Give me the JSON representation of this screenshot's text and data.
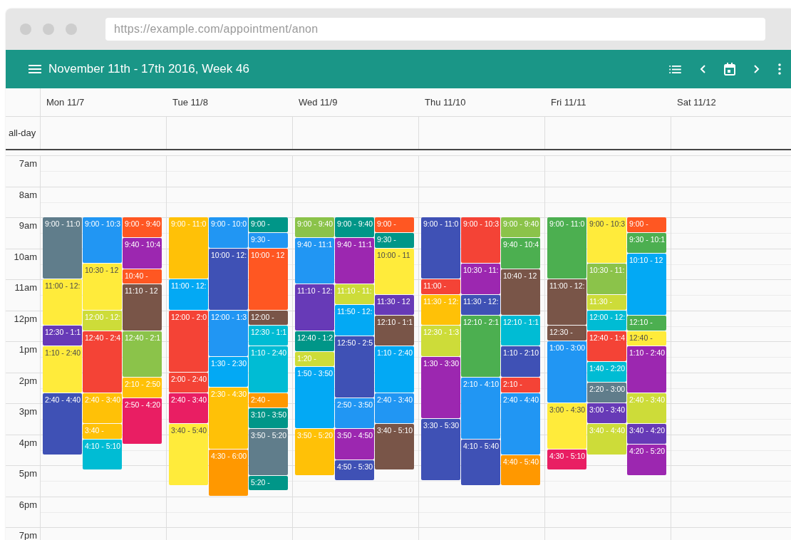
{
  "browser": {
    "url": "https://example.com/appointment/anon"
  },
  "toolbar": {
    "title": "November 11th - 17th 2016, Week 46"
  },
  "all_day_label": "all-day",
  "hours": [
    "7am",
    "8am",
    "9am",
    "10am",
    "11am",
    "12pm",
    "1pm",
    "2pm",
    "3pm",
    "4pm",
    "5pm",
    "6pm",
    "7pm"
  ],
  "days": [
    {
      "label": "Mon 11/7",
      "lanes": [
        [
          {
            "label": "9:00 - 11:0",
            "color": "#607d8b"
          },
          {
            "label": "11:00 - 12:",
            "color": "#ffeb3b"
          },
          {
            "label": "12:30 - 1:1",
            "color": "#673ab7"
          },
          {
            "label": "1:10 - 2:40",
            "color": "#ffeb3b"
          },
          {
            "label": "2:40 - 4:40",
            "color": "#3f51b5"
          }
        ],
        [
          {
            "label": "9:00 - 10:3",
            "color": "#2196f3"
          },
          {
            "label": "10:30 - 12",
            "color": "#ffeb3b"
          },
          {
            "label": "12:00 - 12:",
            "color": "#cddc39"
          },
          {
            "label": "12:40 - 2:4",
            "color": "#f44336"
          },
          {
            "label": "2:40 - 3:40",
            "color": "#ffc107"
          },
          {
            "label": "3:40 -",
            "color": "#ffc107"
          },
          {
            "label": "4:10 - 5:10",
            "color": "#00bcd4"
          }
        ],
        [
          {
            "label": "9:00 - 9:40",
            "color": "#ff5722"
          },
          {
            "label": "9:40 - 10:4",
            "color": "#9c27b0"
          },
          {
            "label": "10:40 -",
            "color": "#ff5722"
          },
          {
            "label": "11:10 - 12",
            "color": "#795548"
          },
          {
            "label": "12:40 - 2:1",
            "color": "#8bc34a"
          },
          {
            "label": "2:10 - 2:50",
            "color": "#ffc107"
          },
          {
            "label": "2:50 - 4:20",
            "color": "#e91e63"
          }
        ]
      ]
    },
    {
      "label": "Tue 11/8",
      "lanes": [
        [
          {
            "label": "9:00 - 11:0",
            "color": "#ffc107"
          },
          {
            "label": "11:00 - 12:",
            "color": "#03a9f4"
          },
          {
            "label": "12:00 - 2:0",
            "color": "#f44336"
          },
          {
            "label": "2:00 - 2:40",
            "color": "#f44336"
          },
          {
            "label": "2:40 - 3:40",
            "color": "#e91e63"
          },
          {
            "label": "3:40 - 5:40",
            "color": "#ffeb3b"
          }
        ],
        [
          {
            "label": "9:00 - 10:0",
            "color": "#2196f3"
          },
          {
            "label": "10:00 - 12:",
            "color": "#3f51b5"
          },
          {
            "label": "12:00 - 1:3",
            "color": "#2196f3"
          },
          {
            "label": "1:30 - 2:30",
            "color": "#03a9f4"
          },
          {
            "label": "2:30 - 4:30",
            "color": "#ffc107"
          },
          {
            "label": "4:30 - 6:00",
            "color": "#ff9800"
          }
        ],
        [
          {
            "label": "9:00 -",
            "color": "#009688"
          },
          {
            "label": "9:30 -",
            "color": "#2196f3"
          },
          {
            "label": "10:00 - 12",
            "color": "#ff5722"
          },
          {
            "label": "12:00 -",
            "color": "#795548"
          },
          {
            "label": "12:30 - 1:1",
            "color": "#00bcd4"
          },
          {
            "label": "1:10 - 2:40",
            "color": "#00bcd4"
          },
          {
            "label": "2:40 -",
            "color": "#ff9800"
          },
          {
            "label": "3:10 - 3:50",
            "color": "#009688"
          },
          {
            "label": "3:50 - 5:20",
            "color": "#607d8b"
          },
          {
            "label": "5:20 -",
            "color": "#009688"
          }
        ]
      ]
    },
    {
      "label": "Wed 11/9",
      "lanes": [
        [
          {
            "label": "9:00 - 9:40",
            "color": "#8bc34a"
          },
          {
            "label": "9:40 - 11:1",
            "color": "#2196f3"
          },
          {
            "label": "11:10 - 12:",
            "color": "#673ab7"
          },
          {
            "label": "12:40 - 1:2",
            "color": "#009688"
          },
          {
            "label": "1:20 -",
            "color": "#cddc39"
          },
          {
            "label": "1:50 - 3:50",
            "color": "#03a9f4"
          },
          {
            "label": "3:50 - 5:20",
            "color": "#ffc107"
          }
        ],
        [
          {
            "label": "9:00 - 9:40",
            "color": "#009688"
          },
          {
            "label": "9:40 - 11:1",
            "color": "#9c27b0"
          },
          {
            "label": "11:10 - 11:",
            "color": "#cddc39"
          },
          {
            "label": "11:50 - 12:",
            "color": "#03a9f4"
          },
          {
            "label": "12:50 - 2:5",
            "color": "#3f51b5"
          },
          {
            "label": "2:50 - 3:50",
            "color": "#2196f3"
          },
          {
            "label": "3:50 - 4:50",
            "color": "#9c27b0"
          },
          {
            "label": "4:50 - 5:30",
            "color": "#3f51b5"
          }
        ],
        [
          {
            "label": "9:00 -",
            "color": "#ff5722"
          },
          {
            "label": "9:30 -",
            "color": "#009688"
          },
          {
            "label": "10:00 - 11",
            "color": "#ffeb3b"
          },
          {
            "label": "11:30 - 12",
            "color": "#673ab7"
          },
          {
            "label": "12:10 - 1:1",
            "color": "#795548"
          },
          {
            "label": "1:10 - 2:40",
            "color": "#03a9f4"
          },
          {
            "label": "2:40 - 3:40",
            "color": "#2196f3"
          },
          {
            "label": "3:40 - 5:10",
            "color": "#795548"
          }
        ]
      ]
    },
    {
      "label": "Thu 11/10",
      "lanes": [
        [
          {
            "label": "9:00 - 11:0",
            "color": "#3f51b5"
          },
          {
            "label": "11:00 -",
            "color": "#f44336"
          },
          {
            "label": "11:30 - 12:",
            "color": "#ffc107"
          },
          {
            "label": "12:30 - 1:3",
            "color": "#cddc39"
          },
          {
            "label": "1:30 - 3:30",
            "color": "#9c27b0"
          },
          {
            "label": "3:30 - 5:30",
            "color": "#3f51b5"
          }
        ],
        [
          {
            "label": "9:00 - 10:3",
            "color": "#f44336"
          },
          {
            "label": "10:30 - 11:",
            "color": "#9c27b0"
          },
          {
            "label": "11:30 - 12:",
            "color": "#3f51b5"
          },
          {
            "label": "12:10 - 2:1",
            "color": "#4caf50"
          },
          {
            "label": "2:10 - 4:10",
            "color": "#2196f3"
          },
          {
            "label": "4:10 - 5:40",
            "color": "#3f51b5"
          }
        ],
        [
          {
            "label": "9:00 - 9:40",
            "color": "#8bc34a"
          },
          {
            "label": "9:40 - 10:4",
            "color": "#4caf50"
          },
          {
            "label": "10:40 - 12",
            "color": "#795548"
          },
          {
            "label": "12:10 - 1:1",
            "color": "#00bcd4"
          },
          {
            "label": "1:10 - 2:10",
            "color": "#3f51b5"
          },
          {
            "label": "2:10 -",
            "color": "#f44336"
          },
          {
            "label": "2:40 - 4:40",
            "color": "#2196f3"
          },
          {
            "label": "4:40 - 5:40",
            "color": "#ff9800"
          }
        ]
      ]
    },
    {
      "label": "Fri 11/11",
      "lanes": [
        [
          {
            "label": "9:00 - 11:0",
            "color": "#4caf50"
          },
          {
            "label": "11:00 - 12:",
            "color": "#795548"
          },
          {
            "label": "12:30 -",
            "color": "#795548"
          },
          {
            "label": "1:00 - 3:00",
            "color": "#2196f3"
          },
          {
            "label": "3:00 - 4:30",
            "color": "#ffeb3b"
          },
          {
            "label": "4:30 - 5:10",
            "color": "#e91e63"
          }
        ],
        [
          {
            "label": "9:00 - 10:3",
            "color": "#ffeb3b"
          },
          {
            "label": "10:30 - 11:",
            "color": "#8bc34a"
          },
          {
            "label": "11:30 -",
            "color": "#cddc39"
          },
          {
            "label": "12:00 - 12:",
            "color": "#00bcd4"
          },
          {
            "label": "12:40 - 1:4",
            "color": "#f44336"
          },
          {
            "label": "1:40 - 2:20",
            "color": "#00bcd4"
          },
          {
            "label": "2:20 - 3:00",
            "color": "#607d8b"
          },
          {
            "label": "3:00 - 3:40",
            "color": "#673ab7"
          },
          {
            "label": "3:40 - 4:40",
            "color": "#cddc39"
          }
        ],
        [
          {
            "label": "9:00 -",
            "color": "#ff5722"
          },
          {
            "label": "9:30 - 10:1",
            "color": "#4caf50"
          },
          {
            "label": "10:10 - 12",
            "color": "#03a9f4"
          },
          {
            "label": "12:10 -",
            "color": "#4caf50"
          },
          {
            "label": "12:40 -",
            "color": "#ffeb3b"
          },
          {
            "label": "1:10 - 2:40",
            "color": "#9c27b0"
          },
          {
            "label": "2:40 - 3:40",
            "color": "#cddc39"
          },
          {
            "label": "3:40 - 4:20",
            "color": "#673ab7"
          },
          {
            "label": "4:20 - 5:20",
            "color": "#9c27b0"
          }
        ]
      ]
    },
    {
      "label": "Sat 11/12"
    }
  ]
}
